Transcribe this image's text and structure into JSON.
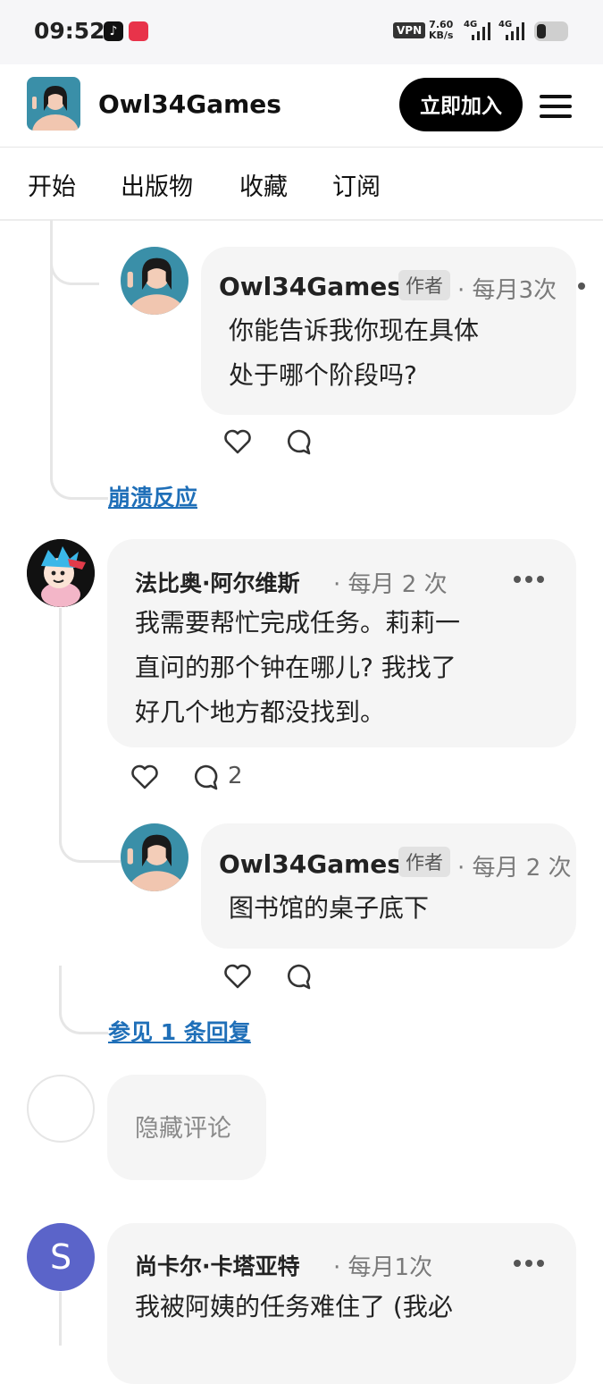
{
  "status_bar": {
    "time": "09:52",
    "vpn": "VPN",
    "speed_value": "7.60",
    "speed_unit": "KB/s",
    "network_1": "4G",
    "network_2": "4G"
  },
  "header": {
    "site_name": "Owl34Games",
    "join_label": "立即加入"
  },
  "nav": {
    "items": [
      "开始",
      "出版物",
      "收藏",
      "订阅"
    ]
  },
  "comments": {
    "reply1": {
      "author": "Owl34Games",
      "badge": "作者",
      "meta": "· 每月3次",
      "text_lines": [
        "你能告诉我你现在具体",
        "处于哪个阶段吗?"
      ]
    },
    "collapse_link": "崩溃反应",
    "comment2": {
      "author": "法比奥·阿尔维斯",
      "meta": "· 每月 2 次",
      "text_lines": [
        "我需要帮忙完成任务。莉莉一",
        "直问的那个钟在哪儿? 我找了",
        "好几个地方都没找到。"
      ],
      "reply_count": "2"
    },
    "reply2": {
      "author": "Owl34Games",
      "badge": "作者",
      "meta": "· 每月 2 次",
      "text_lines": [
        "图书馆的桌子底下"
      ]
    },
    "see_replies_link": "参见 1 条回复",
    "hidden_comment": {
      "text": "隐藏评论"
    },
    "comment3": {
      "avatar_initial": "S",
      "author": "尚卡尔·卡塔亚特",
      "meta": "· 每月1次",
      "text_lines": [
        "我被阿姨的任务难住了 (我必"
      ]
    }
  },
  "colors": {
    "link": "#1f6fb8",
    "avatar_s": "#5b64c9"
  }
}
